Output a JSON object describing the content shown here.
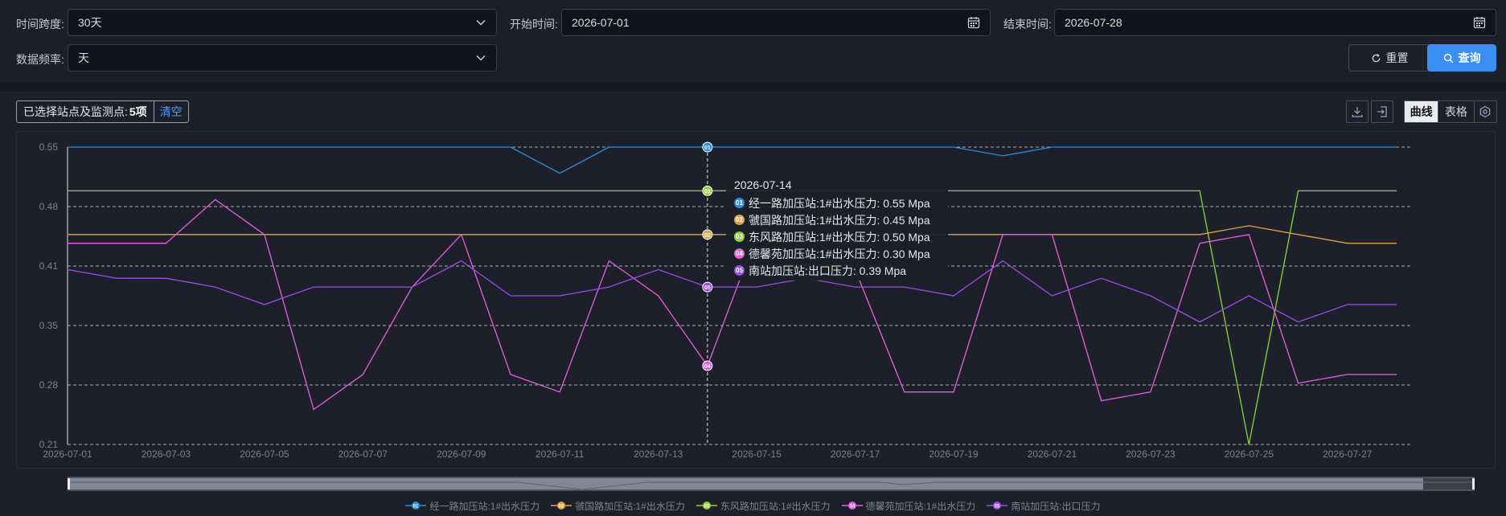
{
  "filters": {
    "span_label": "时间跨度:",
    "span_value": "30天",
    "start_label": "开始时间:",
    "start_value": "2026-07-01",
    "end_label": "结束时间:",
    "end_value": "2026-07-28",
    "freq_label": "数据频率:",
    "freq_value": "天",
    "reset_label": "重置",
    "query_label": "查询"
  },
  "selection": {
    "prefix": "已选择站点及监测点:",
    "count": "5项",
    "clear_label": "清空"
  },
  "view_toggle": {
    "curve_label": "曲线",
    "table_label": "表格",
    "active": "曲线"
  },
  "icons": {
    "chevron": "chevron-down-icon",
    "calendar": "calendar-icon",
    "reset": "refresh-icon",
    "search": "search-icon",
    "download": "download-icon",
    "export": "export-icon",
    "settings": "settings-icon"
  },
  "colors": {
    "accent": "#3a8ef6",
    "s01": "#2a8fde",
    "s02": "#e0a23e",
    "s03": "#8fd13a",
    "s04": "#e45fe0",
    "s05": "#9b4de8"
  },
  "tooltip": {
    "date": "2026-07-14",
    "rows": [
      {
        "badge": "01",
        "text": "经一路加压站:1#出水压力:  0.55 Mpa"
      },
      {
        "badge": "02",
        "text": "虢国路加压站:1#出水压力:  0.45 Mpa"
      },
      {
        "badge": "03",
        "text": "东风路加压站:1#出水压力:  0.50 Mpa"
      },
      {
        "badge": "04",
        "text": "德馨苑加压站:1#出水压力:  0.30 Mpa"
      },
      {
        "badge": "05",
        "text": "南站加压站:出口压力:  0.39 Mpa"
      }
    ]
  },
  "chart_data": {
    "type": "line",
    "ylim": [
      0.21,
      0.55
    ],
    "yticks": [
      "0.55",
      "0.48",
      "0.41",
      "0.35",
      "0.28",
      "0.21"
    ],
    "x": [
      "2026-07-01",
      "2026-07-02",
      "2026-07-03",
      "2026-07-04",
      "2026-07-05",
      "2026-07-06",
      "2026-07-07",
      "2026-07-08",
      "2026-07-09",
      "2026-07-10",
      "2026-07-11",
      "2026-07-12",
      "2026-07-13",
      "2026-07-14",
      "2026-07-15",
      "2026-07-16",
      "2026-07-17",
      "2026-07-18",
      "2026-07-19",
      "2026-07-20",
      "2026-07-21",
      "2026-07-22",
      "2026-07-23",
      "2026-07-24",
      "2026-07-25",
      "2026-07-26",
      "2026-07-27",
      "2026-07-28"
    ],
    "xtick_labels": [
      "2026-07-01",
      "2026-07-03",
      "2026-07-05",
      "2026-07-07",
      "2026-07-09",
      "2026-07-11",
      "2026-07-13",
      "2026-07-15",
      "2026-07-17",
      "2026-07-19",
      "2026-07-21",
      "2026-07-23",
      "2026-07-25",
      "2026-07-27"
    ],
    "grid": true,
    "legend": "bottom-center",
    "highlight_index": 13,
    "series": [
      {
        "badge": "01",
        "name": "经一路加压站:1#出水压力",
        "color": "#2a8fde",
        "values": [
          0.55,
          0.55,
          0.55,
          0.55,
          0.55,
          0.55,
          0.55,
          0.55,
          0.55,
          0.55,
          0.52,
          0.55,
          0.55,
          0.55,
          0.55,
          0.55,
          0.55,
          0.55,
          0.55,
          0.54,
          0.55,
          0.55,
          0.55,
          0.55,
          0.55,
          0.55,
          0.55,
          0.55
        ]
      },
      {
        "badge": "02",
        "name": "虢国路加压站:1#出水压力",
        "color": "#e0a23e",
        "values": [
          0.45,
          0.45,
          0.45,
          0.45,
          0.45,
          0.45,
          0.45,
          0.45,
          0.45,
          0.45,
          0.45,
          0.45,
          0.45,
          0.45,
          0.45,
          0.45,
          0.45,
          0.45,
          0.45,
          0.45,
          0.45,
          0.45,
          0.45,
          0.45,
          0.46,
          0.45,
          0.44,
          0.44
        ]
      },
      {
        "badge": "03",
        "name": "东风路加压站:1#出水压力",
        "color": "#8fd13a",
        "values": [
          0.5,
          0.5,
          0.5,
          0.5,
          0.5,
          0.5,
          0.5,
          0.5,
          0.5,
          0.5,
          0.5,
          0.5,
          0.5,
          0.5,
          0.5,
          0.5,
          0.5,
          0.5,
          0.5,
          0.5,
          0.5,
          0.5,
          0.5,
          0.5,
          0.21,
          0.5,
          0.5,
          0.5
        ]
      },
      {
        "badge": "04",
        "name": "德馨苑加压站:1#出水压力",
        "color": "#e45fe0",
        "values": [
          0.44,
          0.44,
          0.44,
          0.49,
          0.45,
          0.25,
          0.29,
          0.39,
          0.45,
          0.29,
          0.27,
          0.42,
          0.38,
          0.3,
          0.45,
          0.45,
          0.41,
          0.27,
          0.27,
          0.45,
          0.45,
          0.26,
          0.27,
          0.44,
          0.45,
          0.28,
          0.29,
          0.29
        ]
      },
      {
        "badge": "05",
        "name": "南站加压站:出口压力",
        "color": "#9b4de8",
        "values": [
          0.41,
          0.4,
          0.4,
          0.39,
          0.37,
          0.39,
          0.39,
          0.39,
          0.42,
          0.38,
          0.38,
          0.39,
          0.41,
          0.39,
          0.39,
          0.4,
          0.39,
          0.39,
          0.38,
          0.42,
          0.38,
          0.4,
          0.38,
          0.35,
          0.38,
          0.35,
          0.37,
          0.37
        ]
      }
    ]
  }
}
